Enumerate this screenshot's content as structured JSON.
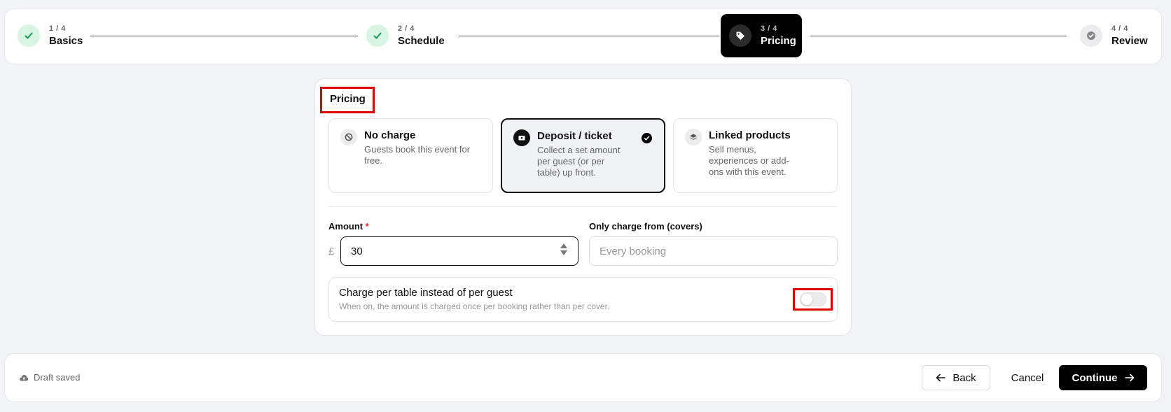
{
  "stepper": {
    "steps": [
      {
        "count": "1 / 4",
        "label": "Basics",
        "state": "done"
      },
      {
        "count": "2 / 4",
        "label": "Schedule",
        "state": "done"
      },
      {
        "count": "3 / 4",
        "label": "Pricing",
        "state": "current"
      },
      {
        "count": "4 / 4",
        "label": "Review",
        "state": "todo"
      }
    ]
  },
  "pricing": {
    "title": "Pricing",
    "options": [
      {
        "title": "No charge",
        "desc": "Guests book this event for free.",
        "icon": "ban-icon",
        "selected": false
      },
      {
        "title": "Deposit / ticket",
        "desc": "Collect a set amount per guest (or per table) up front.",
        "icon": "ticket-icon",
        "selected": true
      },
      {
        "title": "Linked products",
        "desc": "Sell menus, experiences or add-ons with this event.",
        "icon": "layers-icon",
        "selected": false
      }
    ],
    "amount": {
      "label": "Amount",
      "required_mark": "*",
      "currency": "£",
      "value": "30"
    },
    "covers": {
      "label": "Only charge from (covers)",
      "placeholder": "Every booking"
    },
    "per_table": {
      "title": "Charge per table instead of per guest",
      "desc": "When on, the amount is charged once per booking rather than per cover.",
      "enabled": false
    }
  },
  "footer": {
    "draft_status": "Draft saved",
    "back_label": "Back",
    "cancel_label": "Cancel",
    "continue_label": "Continue"
  },
  "colors": {
    "accent": "#000000",
    "done_bg": "#d8f5e4",
    "done_check": "#1a9a5a",
    "highlight": "#e00000"
  }
}
